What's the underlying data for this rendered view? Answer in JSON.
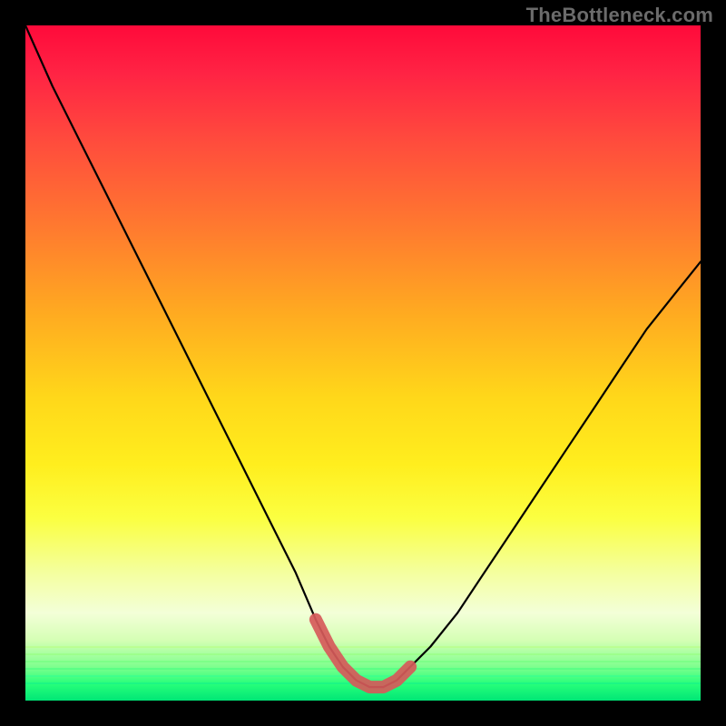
{
  "watermark": "TheBottleneck.com",
  "colors": {
    "background": "#000000",
    "curve": "#000000",
    "highlight": "#d65a5a",
    "gradient_top": "#ff0a3a",
    "gradient_bottom": "#00e676"
  },
  "chart_data": {
    "type": "line",
    "title": "",
    "xlabel": "",
    "ylabel": "",
    "xlim": [
      0,
      100
    ],
    "ylim": [
      0,
      100
    ],
    "series": [
      {
        "name": "bottleneck-curve",
        "x": [
          0,
          4,
          8,
          12,
          16,
          20,
          24,
          28,
          32,
          36,
          40,
          43,
          45,
          47,
          49,
          51,
          53,
          55,
          57,
          60,
          64,
          68,
          72,
          76,
          80,
          84,
          88,
          92,
          96,
          100
        ],
        "y": [
          100,
          91,
          83,
          75,
          67,
          59,
          51,
          43,
          35,
          27,
          19,
          12,
          8,
          5,
          3,
          2,
          2,
          3,
          5,
          8,
          13,
          19,
          25,
          31,
          37,
          43,
          49,
          55,
          60,
          65
        ]
      },
      {
        "name": "highlight-band",
        "x": [
          43,
          45,
          47,
          49,
          51,
          53,
          55,
          57
        ],
        "y": [
          12,
          8,
          5,
          3,
          2,
          2,
          3,
          5
        ]
      }
    ],
    "annotations": []
  }
}
